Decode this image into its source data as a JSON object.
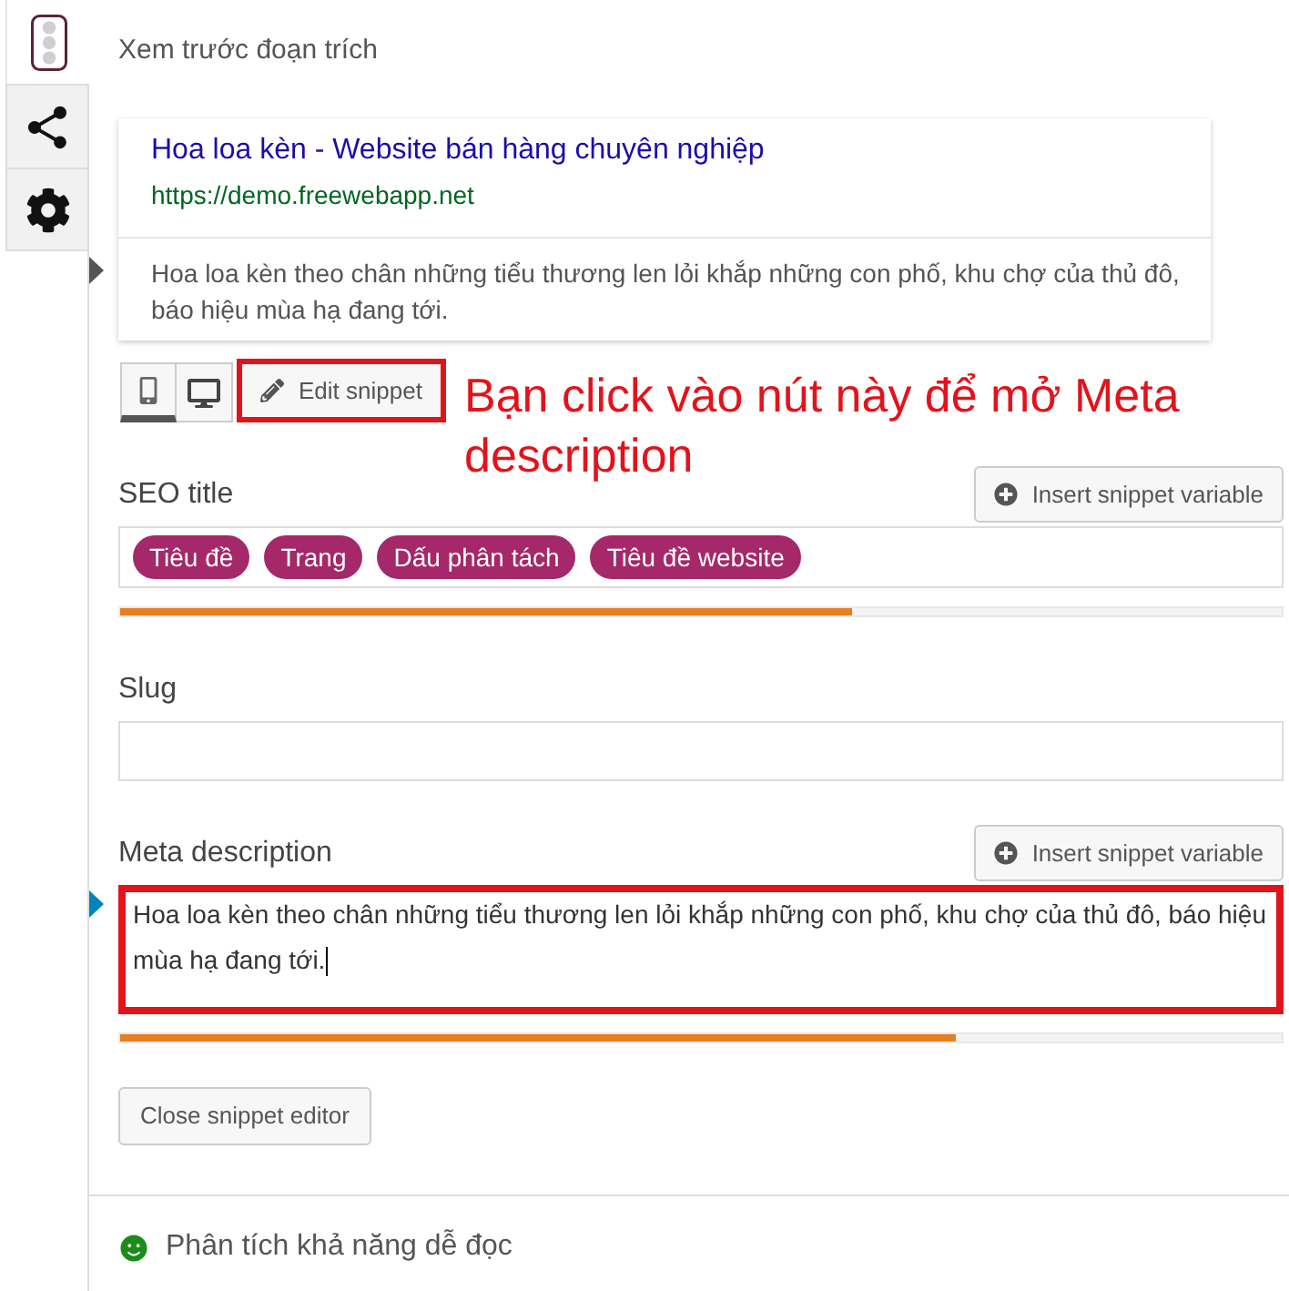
{
  "sidebar_tabs": [
    {
      "selected": true
    },
    {
      "selected": false
    },
    {
      "selected": false
    }
  ],
  "snippet_preview": {
    "heading": "Xem trước đoạn trích",
    "title": "Hoa loa kèn - Website bán hàng chuyên nghiệp",
    "url": "https://demo.freewebapp.net",
    "description": "Hoa loa kèn theo chân những tiểu thương len lỏi khắp những con phố, khu chợ của thủ đô, báo hiệu mùa hạ đang tới."
  },
  "preview_modes": [
    {
      "selected": true
    },
    {
      "selected": false
    }
  ],
  "edit_snippet_button": {
    "label": "Edit snippet",
    "highlighted": true
  },
  "annotation": {
    "text": "Bạn click vào nút này để mở Meta description"
  },
  "fields": [
    {
      "kind": "tags",
      "label": "SEO title",
      "insert_button": "Insert snippet variable",
      "tags": [
        "Tiêu đề",
        "Trang",
        "Dấu phân tách",
        "Tiêu đề website"
      ],
      "level": 0.63,
      "highlighted": false
    },
    {
      "kind": "text",
      "label": "Slug",
      "highlighted": false
    },
    {
      "kind": "textarea",
      "label": "Meta description",
      "insert_button": "Insert snippet variable",
      "value": "Hoa loa kèn theo chân những tiểu thương len lỏi khắp những con phố, khu chợ của thủ đô, báo hiệu mùa hạ đang tới.",
      "level": 0.72,
      "highlighted": true,
      "focused": true
    }
  ],
  "close_button": "Close snippet editor",
  "readability": {
    "label": "Phân tích khả năng dễ đọc"
  }
}
